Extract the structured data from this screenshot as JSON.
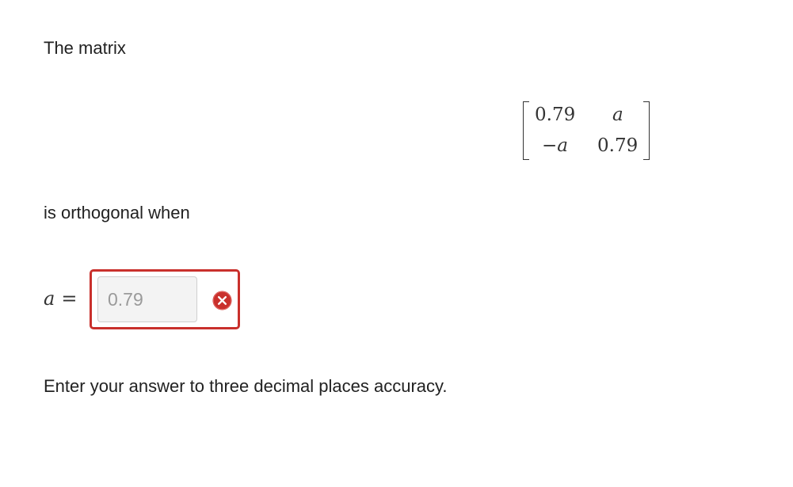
{
  "question": {
    "intro": "The matrix",
    "condition": "is orthogonal when",
    "instructions": "Enter your answer to three decimal places accuracy."
  },
  "matrix": {
    "rows": [
      [
        "0.79",
        "a"
      ],
      [
        "−a",
        "0.79"
      ]
    ]
  },
  "answer": {
    "variable": "a",
    "equals": "=",
    "value": "0.79",
    "status": "incorrect",
    "status_icon": "x-circle-icon",
    "error_color": "#c9302c"
  }
}
